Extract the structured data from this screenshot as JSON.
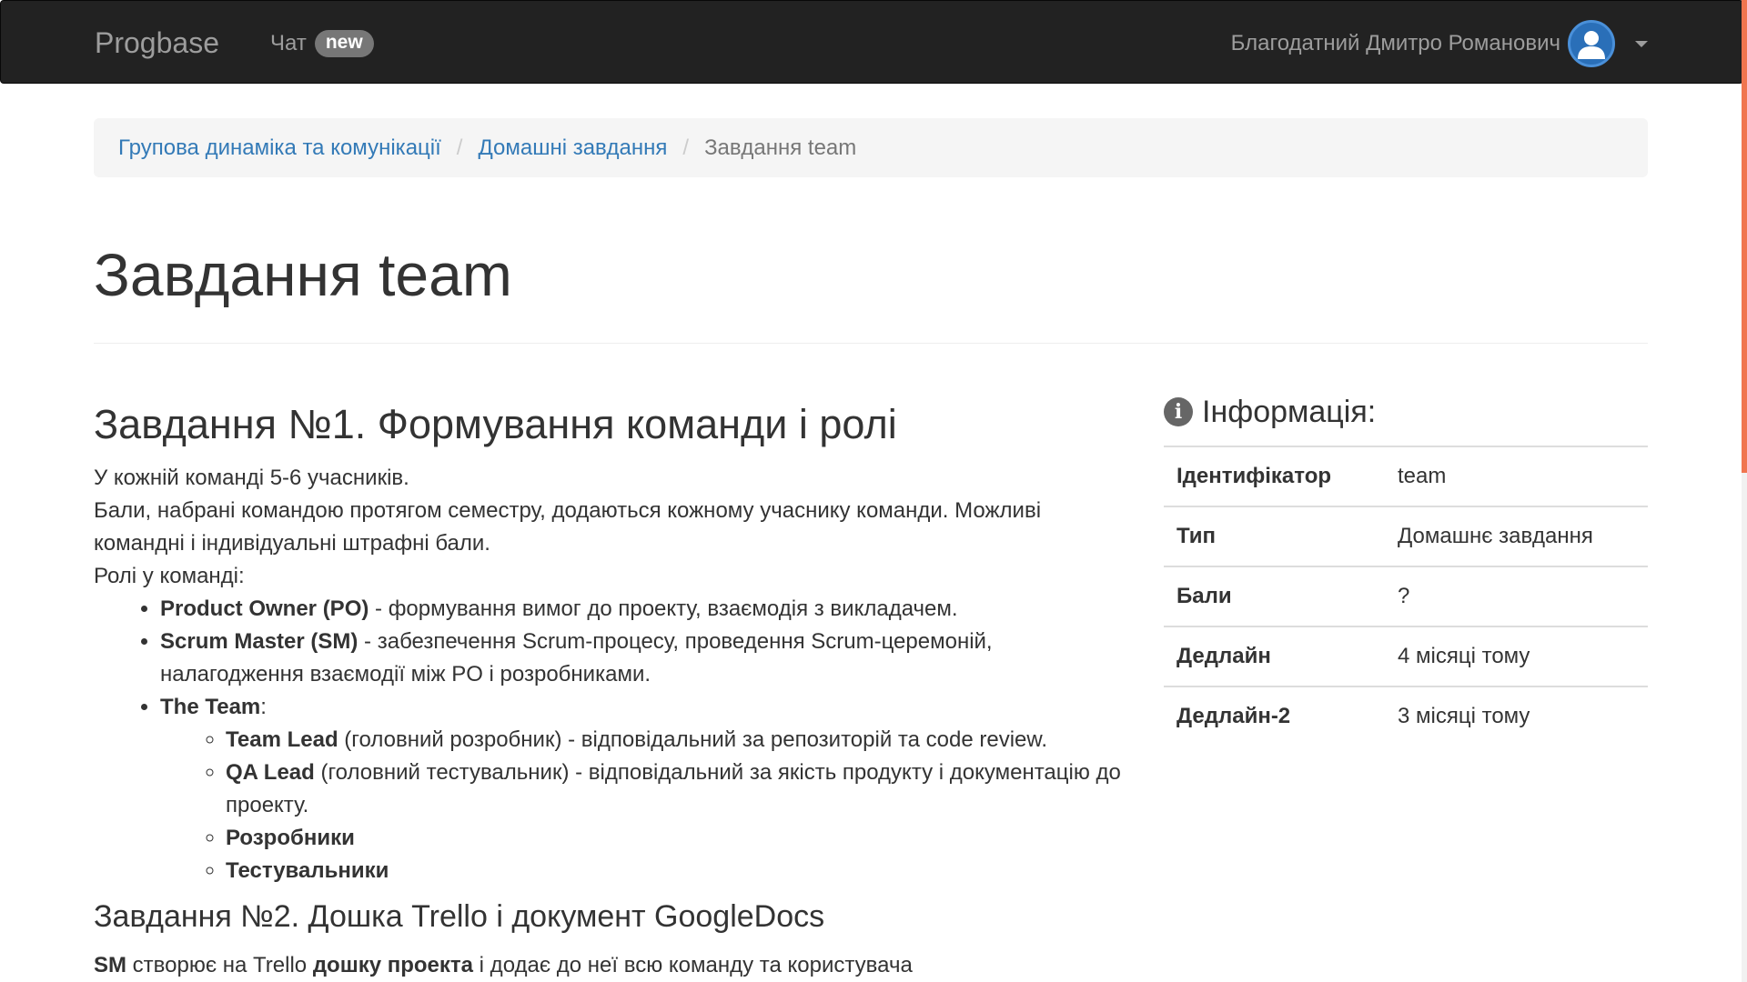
{
  "navbar": {
    "brand": "Progbase",
    "chat_label": "Чат",
    "chat_badge": "new",
    "user_name": "Благодатний Дмитро Романович"
  },
  "breadcrumb": {
    "items": [
      "Групова динаміка та комунікації",
      "Домашні завдання",
      "Завдання team"
    ],
    "separator": "/"
  },
  "page": {
    "title": "Завдання team"
  },
  "content": {
    "task1_heading": "Завдання №1. Формування команди і ролі",
    "para1": "У кожній команді 5-6 учасників.",
    "para2": "Бали, набрані командою протягом семестру, додаються кожному учаснику команди. Можливі командні і індивідуальні штрафні бали.",
    "para3": "Ролі у команді:",
    "roles": [
      {
        "name": "Product Owner (PO)",
        "desc": " - формування вимог до проекту, взаємодія з викладачем."
      },
      {
        "name": "Scrum Master (SM)",
        "desc": " - забезпечення Scrum-процесу, проведення Scrum-церемоній, налагодження взаємодії між PO і розробниками."
      },
      {
        "name": "The Team",
        "desc": ":"
      }
    ],
    "team_roles": [
      {
        "name": "Team Lead",
        "desc": " (головний розробник) - відповідальний за репозиторій та code review."
      },
      {
        "name": "QA Lead",
        "desc": " (головний тестувальник) - відповідальний за якість продукту і документацію до проекту."
      },
      {
        "name": "Розробники",
        "desc": ""
      },
      {
        "name": "Тестувальники",
        "desc": ""
      }
    ],
    "task2_heading": "Завдання №2. Дошка Trello і документ GoogleDocs",
    "task2_para_sm": "SM",
    "task2_para_a": " створює на Trello ",
    "task2_para_board": "дошку проекта",
    "task2_para_b": " і додає до неї всю команду та користувача"
  },
  "sidebar": {
    "heading": "Інформація:",
    "rows": [
      {
        "key": "Ідентифікатор",
        "value": "team"
      },
      {
        "key": "Тип",
        "value": "Домашнє завдання"
      },
      {
        "key": "Бали",
        "value": "?"
      },
      {
        "key": "Дедлайн",
        "value": "4 місяці тому"
      },
      {
        "key": "Дедлайн-2",
        "value": "3 місяці тому"
      }
    ]
  },
  "colors": {
    "navbar_bg": "#222222",
    "link": "#337ab7",
    "breadcrumb_bg": "#f5f5f5",
    "badge_bg": "#777777",
    "scroll_thumb": "#f0754f"
  },
  "icons": {
    "avatar": "user-avatar-icon",
    "caret": "caret-down-icon",
    "info": "info-circle-icon"
  }
}
